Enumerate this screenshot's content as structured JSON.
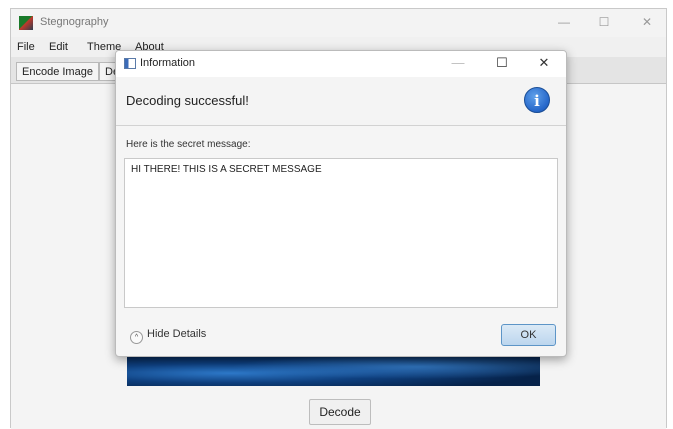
{
  "app": {
    "title": "Stegnography",
    "controls": {
      "minimize": "—",
      "maximize": "☐",
      "close": "✕"
    }
  },
  "menu": {
    "file": "File",
    "edit": "Edit",
    "theme": "Theme",
    "about": "About"
  },
  "tabs": {
    "encode": "Encode Image",
    "decode": "De"
  },
  "main": {
    "decode_button": "Decode"
  },
  "dialog": {
    "title": "Information",
    "controls": {
      "minimize": "—",
      "maximize": "☐",
      "close": "✕"
    },
    "header": "Decoding successful!",
    "info_icon": "i",
    "label": "Here is the secret message:",
    "message": "HI THERE! THIS IS A SECRET MESSAGE",
    "hide_details": "Hide Details",
    "chevron": "^",
    "ok": "OK"
  },
  "colors": {
    "accent": "#2566c9",
    "ok_border": "#5d95c7"
  },
  "icons": {
    "app": "app-icon",
    "dialog": "window-icon",
    "info": "info-icon",
    "details": "chevron-up-icon"
  }
}
